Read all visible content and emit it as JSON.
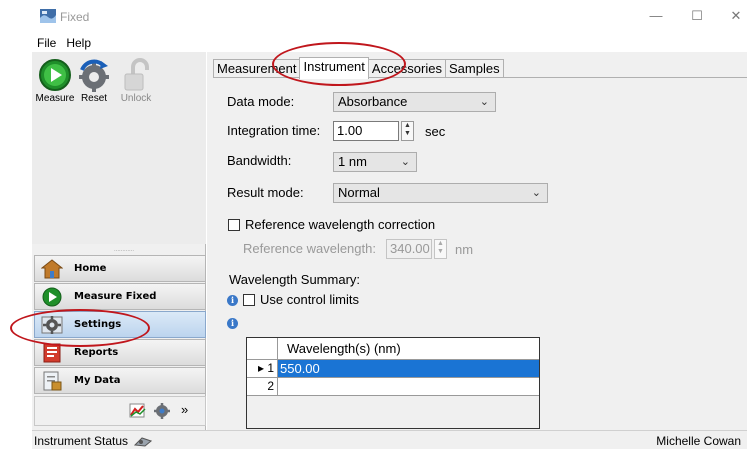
{
  "window": {
    "title": "Fixed",
    "minimize_glyph": "—",
    "maximize_glyph": "☐",
    "close_glyph": "✕"
  },
  "menu": {
    "items": [
      {
        "label": "File"
      },
      {
        "label": "Help"
      }
    ]
  },
  "toolbar": {
    "measure_label": "Measure",
    "reset_label": "Reset",
    "unlock_label": "Unlock"
  },
  "splitter": {
    "grip": "............"
  },
  "nav": {
    "items": [
      {
        "label": "Home",
        "icon": "home-icon",
        "active": false
      },
      {
        "label": "Measure Fixed",
        "icon": "measure-fixed-icon",
        "active": false
      },
      {
        "label": "Settings",
        "icon": "settings-icon",
        "active": true
      },
      {
        "label": "Reports",
        "icon": "reports-icon",
        "active": false
      },
      {
        "label": "My Data",
        "icon": "my-data-icon",
        "active": false
      }
    ],
    "footer_overflow": "»"
  },
  "tabs": [
    {
      "label": "Measurement",
      "active": false
    },
    {
      "label": "Instrument",
      "active": true
    },
    {
      "label": "Accessories",
      "active": false
    },
    {
      "label": "Samples",
      "active": false
    }
  ],
  "instrument": {
    "data_mode": {
      "label": "Data mode:",
      "value": "Absorbance"
    },
    "integration_time": {
      "label": "Integration time:",
      "value": "1.00",
      "unit": "sec"
    },
    "bandwidth": {
      "label": "Bandwidth:",
      "value": "1 nm"
    },
    "result_mode": {
      "label": "Result mode:",
      "value": "Normal"
    },
    "reference_correction": {
      "label": "Reference wavelength correction",
      "checked": false
    },
    "reference_wavelength": {
      "label": "Reference wavelength:",
      "value": "340.00",
      "unit": "nm",
      "enabled": false
    }
  },
  "wavelength_summary": {
    "title": "Wavelength Summary:",
    "use_control_limits": {
      "label": "Use control limits",
      "checked": false
    },
    "info_glyph": "i",
    "grid": {
      "column_header": "Wavelength(s) (nm)",
      "rows": [
        {
          "row_label": "▸ 1",
          "value": "550.00",
          "selected": true
        },
        {
          "row_label": "2",
          "value": "",
          "selected": false
        }
      ]
    }
  },
  "status": {
    "left": "Instrument Status",
    "right": "Michelle Cowan"
  },
  "colors": {
    "annotation": "#c0161c",
    "selection": "#1a74d4",
    "nav_active": "#bcd4ee"
  }
}
